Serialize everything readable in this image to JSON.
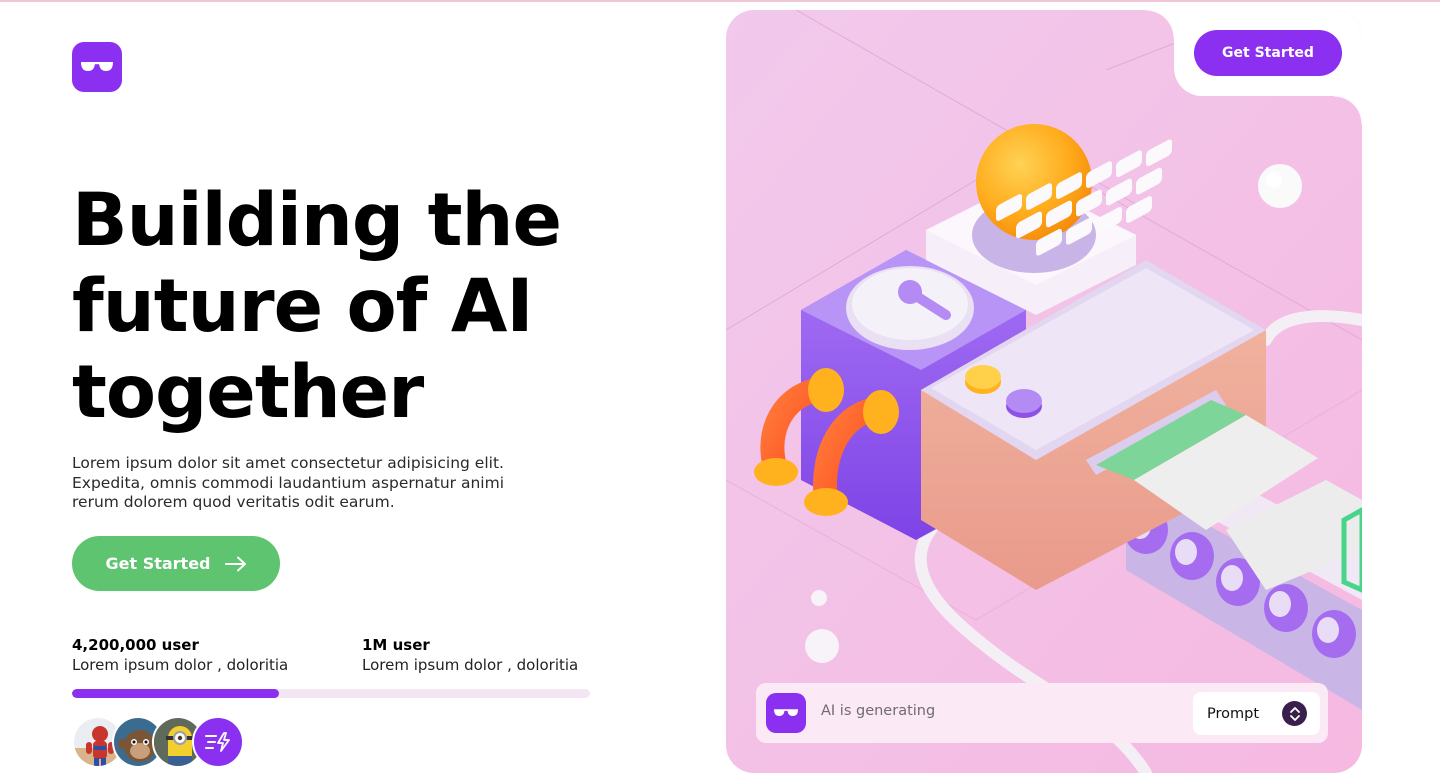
{
  "brand": {
    "accent": "#8b2ff0",
    "green": "#5ec46f",
    "logo_icon": "glasses-icon"
  },
  "header": {
    "cta_label": "Get Started"
  },
  "hero": {
    "title_lines": [
      "Building the",
      "future of AI",
      "together"
    ],
    "description": "Lorem ipsum dolor sit amet consectetur adipisicing elit. Expedita, omnis commodi laudantium aspernatur animi rerum dolorem quod veritatis odit earum.",
    "cta_label": "Get Started",
    "cta_icon": "arrow-right-icon"
  },
  "stats": [
    {
      "value": "4,200,000 user",
      "description": "Lorem ipsum dolor , doloritia"
    },
    {
      "value": "1M user",
      "description": "Lorem ipsum dolor , doloritia"
    }
  ],
  "progress": {
    "fraction": 0.4
  },
  "avatars": {
    "items": [
      "avatar-superhero",
      "avatar-monkey",
      "avatar-minion"
    ],
    "more_icon": "lightning-list-icon"
  },
  "generator": {
    "status_text": "AI is generating",
    "prompt_label": "Prompt",
    "prompt_icon": "chevron-up-down-icon"
  }
}
